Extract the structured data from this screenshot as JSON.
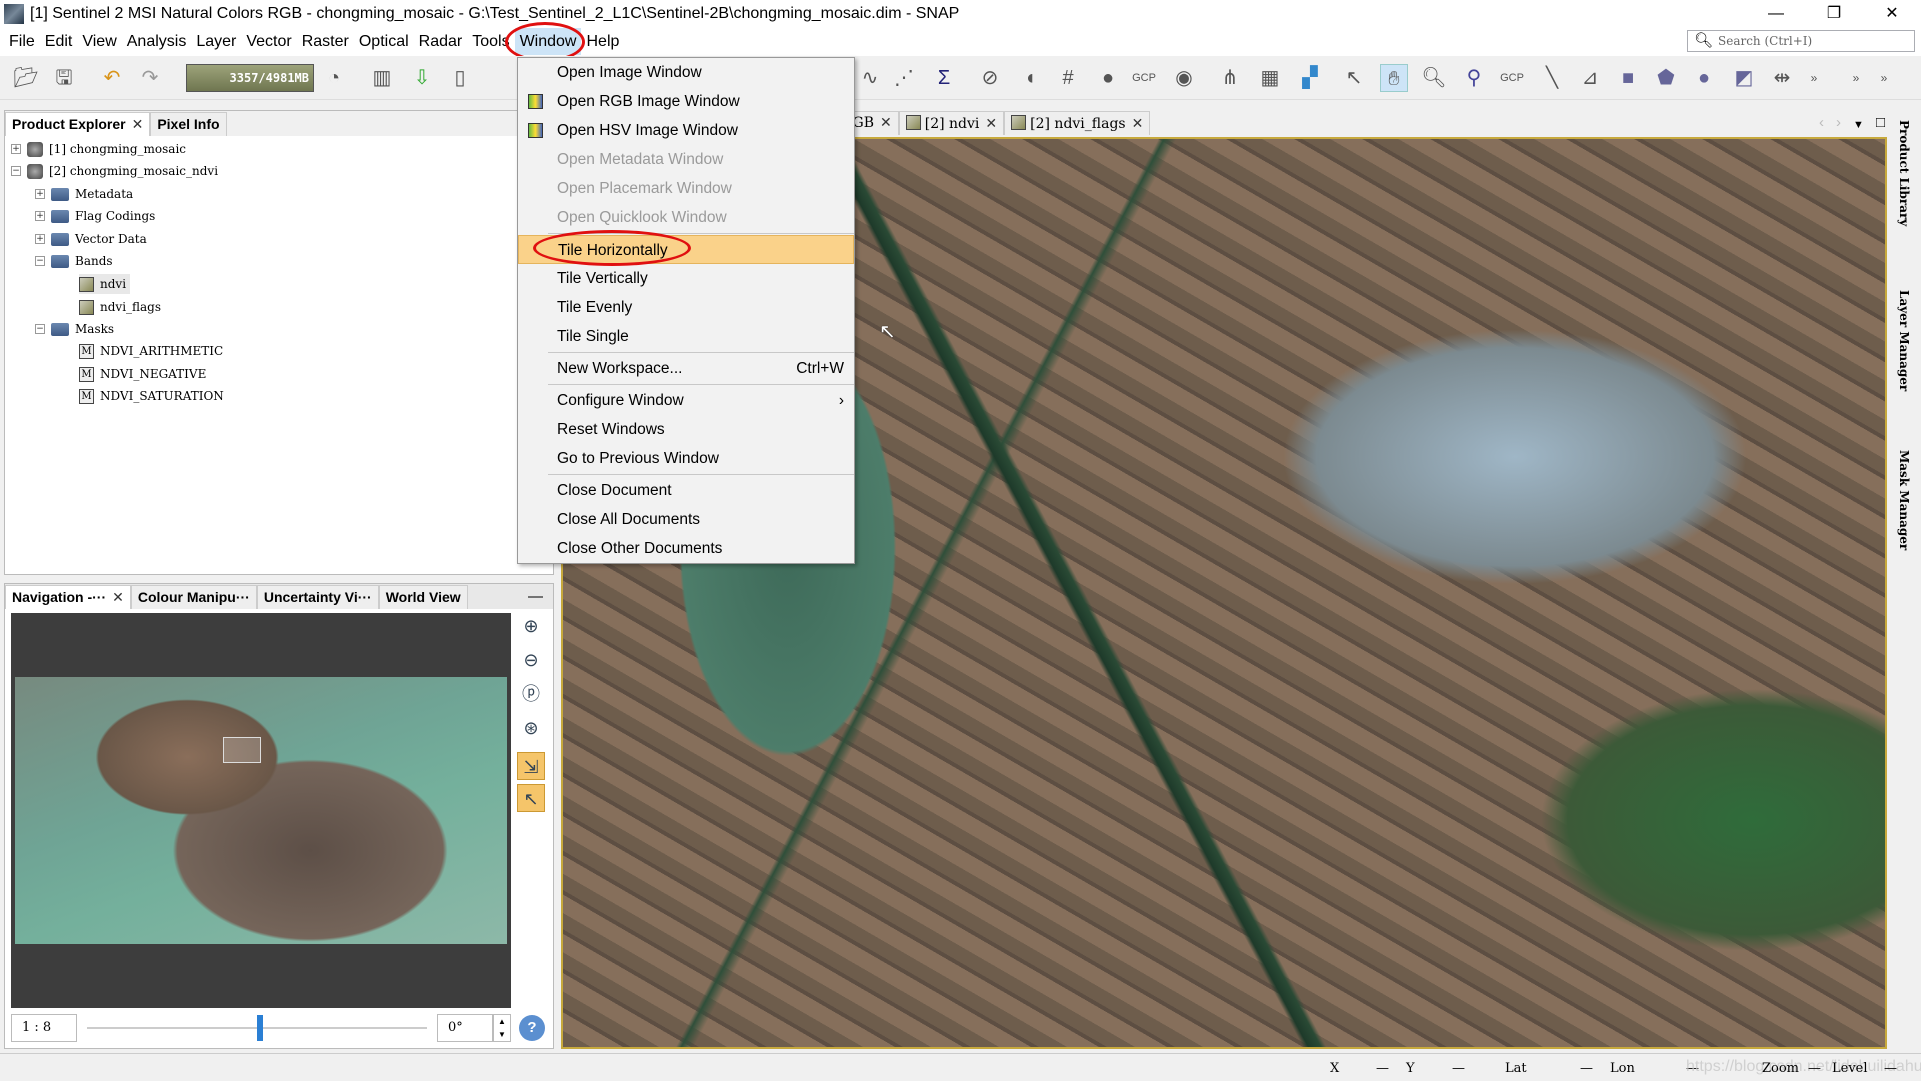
{
  "window": {
    "title": "[1] Sentinel 2 MSI Natural Colors RGB - chongming_mosaic - G:\\Test_Sentinel_2_L1C\\Sentinel-2B\\chongming_mosaic.dim - SNAP",
    "minimize": "—",
    "restore": "❐",
    "close": "✕"
  },
  "menubar": [
    "File",
    "Edit",
    "View",
    "Analysis",
    "Layer",
    "Vector",
    "Raster",
    "Optical",
    "Radar",
    "Tools",
    "Window",
    "Help"
  ],
  "search": {
    "placeholder": "Search (Ctrl+I)"
  },
  "toolbar": {
    "memory": "3357/4981MB",
    "gcp1": "GCP",
    "gcp2": "GCP"
  },
  "leftTop": {
    "tabs": [
      {
        "label": "Product Explorer",
        "close": "✕"
      },
      {
        "label": "Pixel Info"
      }
    ],
    "tree": [
      "[1] chongming_mosaic",
      "[2] chongming_mosaic_ndvi",
      "Metadata",
      "Flag Codings",
      "Vector Data",
      "Bands",
      "ndvi",
      "ndvi_flags",
      "Masks",
      "NDVI_ARITHMETIC",
      "NDVI_NEGATIVE",
      "NDVI_SATURATION"
    ]
  },
  "leftBot": {
    "tabs": [
      {
        "label": "Navigation -···",
        "close": "✕"
      },
      {
        "label": "Colour Manipu···"
      },
      {
        "label": "Uncertainty Vi···"
      },
      {
        "label": "World View"
      }
    ],
    "minimize": "—",
    "scale": "1 : 8",
    "rotation": "0°",
    "slider_fraction": 0.5,
    "help": "?"
  },
  "docTabs": [
    {
      "label": "RGB",
      "close": "✕"
    },
    {
      "label": "[2] ndvi",
      "close": "✕"
    },
    {
      "label": "[2] ndvi_flags",
      "close": "✕"
    }
  ],
  "rightSide": [
    "Product Library",
    "Layer Manager",
    "Mask Manager"
  ],
  "status": {
    "x": "X",
    "xv": "—",
    "y": "Y",
    "yv": "—",
    "lat": "Lat",
    "latv": "—",
    "lon": "Lon",
    "lonv": "—",
    "zoom": "Zoom",
    "zoomv": "—",
    "level": "Level",
    "levelv": "—",
    "watermark": "https://blog.csdn.net/lidahuilidahui"
  },
  "windowMenu": {
    "groups": [
      [
        {
          "label": "Open Image Window"
        },
        {
          "label": "Open RGB Image Window",
          "icon": true
        },
        {
          "label": "Open HSV Image Window",
          "icon": true
        },
        {
          "label": "Open Metadata Window",
          "disabled": true
        },
        {
          "label": "Open Placemark Window",
          "disabled": true
        },
        {
          "label": "Open Quicklook Window",
          "disabled": true
        }
      ],
      [
        {
          "label": "Tile Horizontally",
          "highlighted": true
        },
        {
          "label": "Tile Vertically"
        },
        {
          "label": "Tile Evenly"
        },
        {
          "label": "Tile Single"
        }
      ],
      [
        {
          "label": "New Workspace...",
          "shortcut": "Ctrl+W"
        }
      ],
      [
        {
          "label": "Configure Window",
          "submenu": "›"
        },
        {
          "label": "Reset Windows"
        },
        {
          "label": "Go to Previous Window"
        }
      ],
      [
        {
          "label": "Close Document"
        },
        {
          "label": "Close All Documents"
        },
        {
          "label": "Close Other Documents"
        }
      ]
    ]
  },
  "colors": {
    "highlight": "#fad28a",
    "annotation": "#e01010",
    "menuActive": "#cde4f7"
  }
}
